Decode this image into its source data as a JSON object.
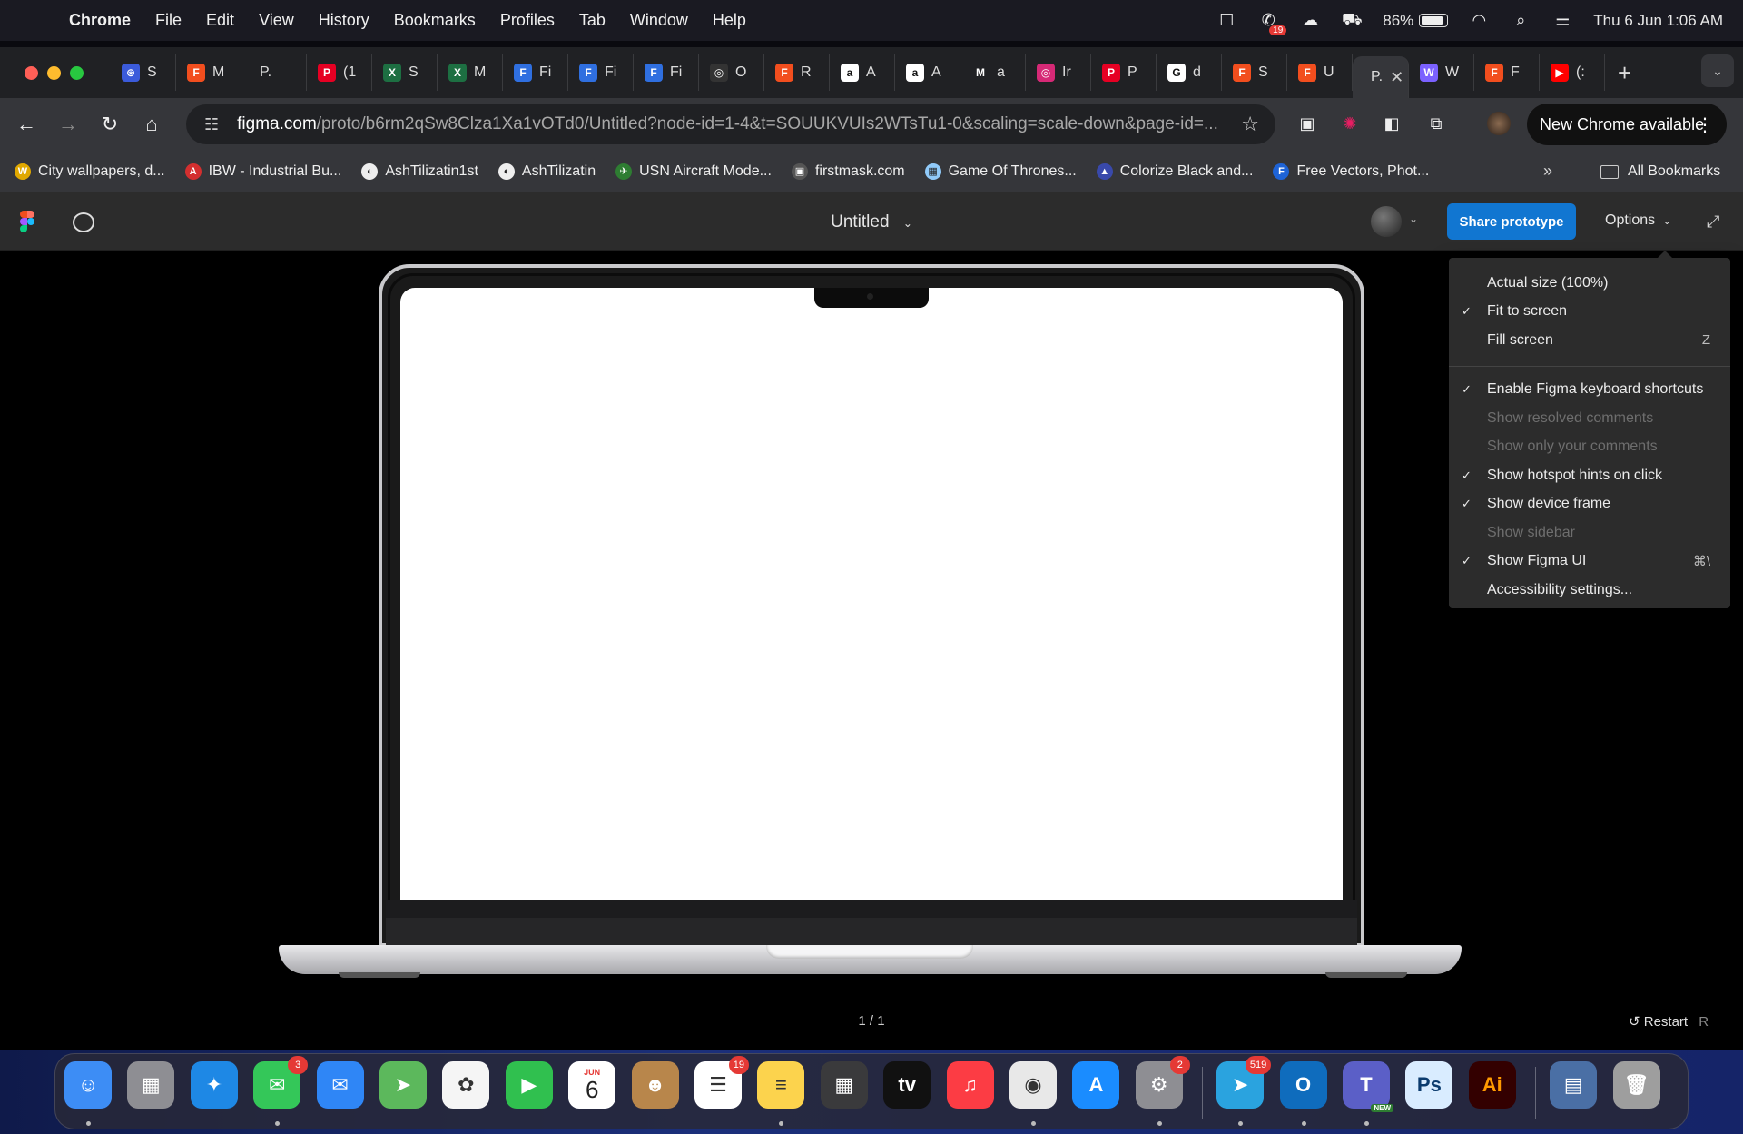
{
  "menubar": {
    "app": "Chrome",
    "items": [
      "File",
      "Edit",
      "View",
      "History",
      "Bookmarks",
      "Profiles",
      "Tab",
      "Window",
      "Help"
    ],
    "battery": "86%",
    "battery_level": 0.86,
    "datetime": "Thu 6 Jun  1:06 AM",
    "notification_badge": "19"
  },
  "tabs": [
    {
      "label": "S",
      "icon": "chatgpt-icon",
      "color": "#3b5bdb",
      "glyph": "⊛"
    },
    {
      "label": "M",
      "icon": "figma-icon",
      "color": "#f24e1e",
      "glyph": "F"
    },
    {
      "label": "P.",
      "icon": "blank-icon",
      "color": "#202124",
      "glyph": ""
    },
    {
      "label": "(1",
      "icon": "pinterest-icon",
      "color": "#e60023",
      "glyph": "P"
    },
    {
      "label": "S",
      "icon": "excel-icon",
      "color": "#1d6f42",
      "glyph": "X"
    },
    {
      "label": "M",
      "icon": "excel-icon",
      "color": "#1d6f42",
      "glyph": "X"
    },
    {
      "label": "Fi",
      "icon": "forms-icon",
      "color": "#2f6fe0",
      "glyph": "F"
    },
    {
      "label": "Fi",
      "icon": "forms-icon",
      "color": "#2f6fe0",
      "glyph": "F"
    },
    {
      "label": "Fi",
      "icon": "forms-icon",
      "color": "#2f6fe0",
      "glyph": "F"
    },
    {
      "label": "O",
      "icon": "openai-icon",
      "color": "#333",
      "glyph": "◎"
    },
    {
      "label": "R",
      "icon": "figma-icon",
      "color": "#f24e1e",
      "glyph": "F"
    },
    {
      "label": "A",
      "icon": "amazon-icon",
      "color": "#ffffff",
      "glyph": "a"
    },
    {
      "label": "A",
      "icon": "amazon-icon",
      "color": "#ffffff",
      "glyph": "a"
    },
    {
      "label": "a",
      "icon": "gmail-icon",
      "color": "#202124",
      "glyph": "M"
    },
    {
      "label": "Ir",
      "icon": "instagram-icon",
      "color": "#d62976",
      "glyph": "◎"
    },
    {
      "label": "P",
      "icon": "pinterest-icon",
      "color": "#e60023",
      "glyph": "P"
    },
    {
      "label": "d",
      "icon": "google-icon",
      "color": "#ffffff",
      "glyph": "G"
    },
    {
      "label": "S",
      "icon": "figma-icon",
      "color": "#f24e1e",
      "glyph": "F"
    },
    {
      "label": "U",
      "icon": "figma-icon",
      "color": "#f24e1e",
      "glyph": "F"
    },
    {
      "label": "P.",
      "icon": "none",
      "color": "#35363a",
      "glyph": "",
      "active": true
    },
    {
      "label": "W",
      "icon": "wix-icon",
      "color": "#7b61ff",
      "glyph": "W"
    },
    {
      "label": "F",
      "icon": "figma-icon",
      "color": "#f24e1e",
      "glyph": "F"
    },
    {
      "label": "(:",
      "icon": "youtube-icon",
      "color": "#ff0000",
      "glyph": "▶"
    }
  ],
  "omnibox": {
    "host": "figma.com",
    "path": "/proto/b6rm2qSw8Clza1Xa1vOTd0/Untitled?node-id=1-4&t=SOUUKVUIs2WTsTu1-0&scaling=scale-down&page-id=..."
  },
  "new_chrome": "New Chrome available",
  "bookmarks": [
    {
      "label": "City wallpapers, d...",
      "color": "#e0a800",
      "glyph": "W"
    },
    {
      "label": "IBW - Industrial Bu...",
      "color": "#d32f2f",
      "glyph": "A"
    },
    {
      "label": "AshTilizatin1st",
      "color": "#eeeeee",
      "glyph": "◐"
    },
    {
      "label": "AshTilizatin",
      "color": "#eeeeee",
      "glyph": "◐"
    },
    {
      "label": "USN Aircraft Mode...",
      "color": "#2e7d32",
      "glyph": "✈"
    },
    {
      "label": "firstmask.com",
      "color": "#555555",
      "glyph": "▣"
    },
    {
      "label": "Game Of Thrones...",
      "color": "#90caf9",
      "glyph": "▦"
    },
    {
      "label": "Colorize Black and...",
      "color": "#3949ab",
      "glyph": "▲"
    },
    {
      "label": "Free Vectors, Phot...",
      "color": "#1e63d6",
      "glyph": "F"
    }
  ],
  "all_bookmarks": "All Bookmarks",
  "figma": {
    "title": "Untitled",
    "share_button": "Share prototype",
    "options_button": "Options",
    "page_counter": "1 / 1",
    "restart_label": "Restart",
    "restart_key": "R"
  },
  "options_menu": {
    "group1": [
      {
        "label": "Actual size (100%)",
        "checked": false,
        "disabled": false,
        "shortcut": ""
      },
      {
        "label": "Fit to screen",
        "checked": true,
        "disabled": false,
        "shortcut": ""
      },
      {
        "label": "Fill screen",
        "checked": false,
        "disabled": false,
        "shortcut": "Z"
      }
    ],
    "group2": [
      {
        "label": "Enable Figma keyboard shortcuts",
        "checked": true,
        "disabled": false,
        "shortcut": ""
      },
      {
        "label": "Show resolved comments",
        "checked": false,
        "disabled": true,
        "shortcut": ""
      },
      {
        "label": "Show only your comments",
        "checked": false,
        "disabled": true,
        "shortcut": ""
      },
      {
        "label": "Show hotspot hints on click",
        "checked": true,
        "disabled": false,
        "shortcut": ""
      },
      {
        "label": "Show device frame",
        "checked": true,
        "disabled": false,
        "shortcut": ""
      },
      {
        "label": "Show sidebar",
        "checked": false,
        "disabled": true,
        "shortcut": ""
      },
      {
        "label": "Show Figma UI",
        "checked": true,
        "disabled": false,
        "shortcut": "⌘\\"
      },
      {
        "label": "Accessibility settings...",
        "checked": false,
        "disabled": false,
        "shortcut": ""
      }
    ]
  },
  "dock": [
    {
      "name": "finder-icon",
      "color": "#3d8df5",
      "glyph": "☺",
      "badge": "",
      "running": true
    },
    {
      "name": "launchpad-icon",
      "color": "#8e8e93",
      "glyph": "▦",
      "badge": "",
      "running": false
    },
    {
      "name": "safari-icon",
      "color": "#1e88e5",
      "glyph": "✦",
      "badge": "",
      "running": false
    },
    {
      "name": "messages-icon",
      "color": "#34c759",
      "glyph": "✉",
      "badge": "3",
      "running": true
    },
    {
      "name": "mail-icon",
      "color": "#2f86f6",
      "glyph": "✉",
      "badge": "",
      "running": false
    },
    {
      "name": "maps-icon",
      "color": "#5cb85c",
      "glyph": "➤",
      "badge": "",
      "running": false
    },
    {
      "name": "photos-icon",
      "color": "#f5f5f5",
      "glyph": "✿",
      "badge": "",
      "running": false
    },
    {
      "name": "facetime-icon",
      "color": "#30c04f",
      "glyph": "▶",
      "badge": "",
      "running": false
    },
    {
      "name": "calendar-icon",
      "color": "#ffffff",
      "glyph": "6",
      "badge": "",
      "running": false
    },
    {
      "name": "contacts-icon",
      "color": "#b8864b",
      "glyph": "☻",
      "badge": "",
      "running": false
    },
    {
      "name": "reminders-icon",
      "color": "#ffffff",
      "glyph": "☰",
      "badge": "19",
      "running": false
    },
    {
      "name": "notes-icon",
      "color": "#fcd34d",
      "glyph": "≡",
      "badge": "",
      "running": true
    },
    {
      "name": "calculator-icon",
      "color": "#3a3a3c",
      "glyph": "▦",
      "badge": "",
      "running": false
    },
    {
      "name": "apple-tv-icon",
      "color": "#111111",
      "glyph": "tv",
      "badge": "",
      "running": false
    },
    {
      "name": "music-icon",
      "color": "#fc3c44",
      "glyph": "♫",
      "badge": "",
      "running": false
    },
    {
      "name": "chrome-icon",
      "color": "#e8e8e8",
      "glyph": "◉",
      "badge": "",
      "running": true
    },
    {
      "name": "app-store-icon",
      "color": "#1a8cff",
      "glyph": "A",
      "badge": "",
      "running": false
    },
    {
      "name": "system-settings-icon",
      "color": "#8e8e93",
      "glyph": "⚙",
      "badge": "2",
      "running": true
    },
    {
      "name": "telegram-icon",
      "color": "#2aa3df",
      "glyph": "➤",
      "badge": "519",
      "running": true
    },
    {
      "name": "outlook-icon",
      "color": "#0f6cbd",
      "glyph": "O",
      "badge": "",
      "running": true
    },
    {
      "name": "teams-icon",
      "color": "#5b5fc7",
      "glyph": "T",
      "badge": "",
      "running": true
    },
    {
      "name": "photoshop-icon",
      "color": "#d9ecff",
      "glyph": "Ps",
      "badge": "",
      "running": false
    },
    {
      "name": "illustrator-icon",
      "color": "#330000",
      "glyph": "Ai",
      "badge": "",
      "running": false
    },
    {
      "name": "downloads-stack-icon",
      "color": "#4a6fa5",
      "glyph": "▤",
      "badge": "",
      "running": false
    },
    {
      "name": "trash-icon",
      "color": "#9e9e9e",
      "glyph": "🗑",
      "badge": "",
      "running": false
    }
  ],
  "teams_new_label": "NEW",
  "calendar_month": "JUN",
  "colors": {
    "share_blue": "#1176d1",
    "figma_header": "#2c2c2c",
    "chrome_toolbar": "#35363a"
  }
}
